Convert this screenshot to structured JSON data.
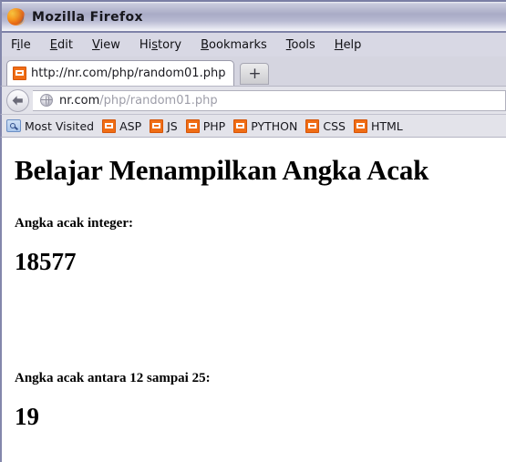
{
  "window": {
    "title": "Mozilla Firefox",
    "logo_icon": "firefox-logo-icon"
  },
  "menubar": {
    "items": [
      {
        "pre": "F",
        "key": "i",
        "post": "le",
        "name": "file"
      },
      {
        "pre": "",
        "key": "E",
        "post": "dit",
        "name": "edit"
      },
      {
        "pre": "",
        "key": "V",
        "post": "iew",
        "name": "view"
      },
      {
        "pre": "Hi",
        "key": "s",
        "post": "tory",
        "name": "history"
      },
      {
        "pre": "",
        "key": "B",
        "post": "ookmarks",
        "name": "bookmarks"
      },
      {
        "pre": "",
        "key": "T",
        "post": "ools",
        "name": "tools"
      },
      {
        "pre": "",
        "key": "H",
        "post": "elp",
        "name": "help"
      }
    ]
  },
  "tabs": {
    "active": {
      "label": "http://nr.com/php/random01.php",
      "favicon": "page-favicon-icon"
    },
    "new_tab_label": "+"
  },
  "navbar": {
    "back_icon": "back-arrow-icon",
    "identity_icon": "globe-icon",
    "url_host": "nr.com",
    "url_path": "/php/random01.php",
    "url_full": "nr.com/php/random01.php"
  },
  "bookmarks": {
    "items": [
      {
        "label": "Most Visited",
        "icon": "folder-search-icon"
      },
      {
        "label": "ASP",
        "icon": "page-favicon-icon"
      },
      {
        "label": "JS",
        "icon": "page-favicon-icon"
      },
      {
        "label": "PHP",
        "icon": "page-favicon-icon"
      },
      {
        "label": "PYTHON",
        "icon": "page-favicon-icon"
      },
      {
        "label": "CSS",
        "icon": "page-favicon-icon"
      },
      {
        "label": "HTML",
        "icon": "page-favicon-icon"
      }
    ]
  },
  "page": {
    "heading": "Belajar Menampilkan Angka Acak",
    "section1_label": "Angka acak integer:",
    "section1_value": "18577",
    "section2_label": "Angka acak antara 12 sampai 25:",
    "section2_value": "19"
  },
  "colors": {
    "titlebar_accent": "#a9abc6",
    "favicon_orange": "#f06d15",
    "window_border": "#8387ab",
    "toolbar_bg": "#e3e3ea"
  }
}
